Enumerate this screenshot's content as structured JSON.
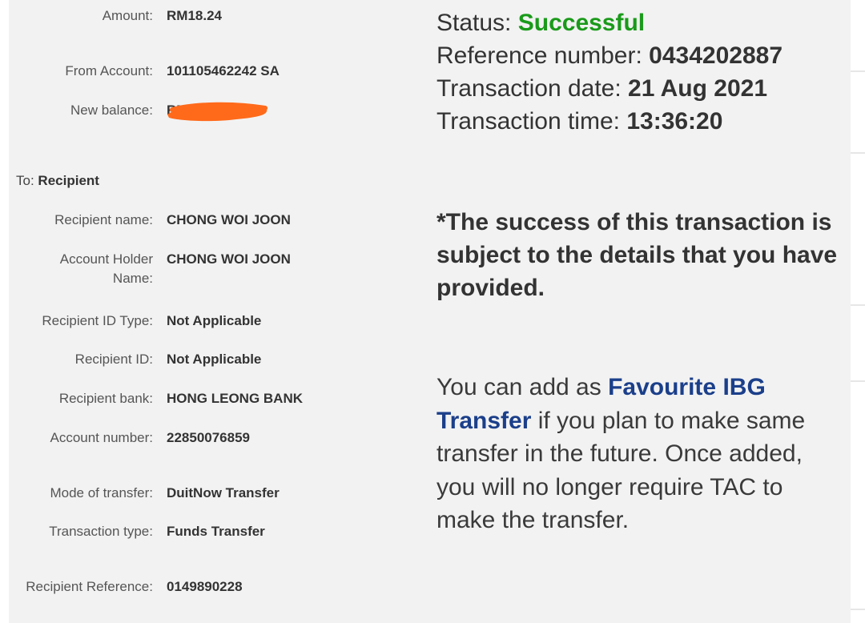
{
  "details": {
    "amount_label": "Amount:",
    "amount_value": "RM18.24",
    "from_account_label": "From Account:",
    "from_account_value": "101105462242 SA",
    "new_balance_label": "New balance:",
    "new_balance_value": "RM",
    "to_label": "To:",
    "to_value": "Recipient",
    "recipient_name_label": "Recipient name:",
    "recipient_name_value": "CHONG WOI JOON",
    "account_holder_label": "Account Holder Name:",
    "account_holder_value": "CHONG WOI JOON",
    "recipient_id_type_label": "Recipient ID Type:",
    "recipient_id_type_value": "Not Applicable",
    "recipient_id_label": "Recipient ID:",
    "recipient_id_value": "Not Applicable",
    "recipient_bank_label": "Recipient bank:",
    "recipient_bank_value": "HONG LEONG BANK",
    "account_number_label": "Account number:",
    "account_number_value": "22850076859",
    "mode_label": "Mode of transfer:",
    "mode_value": "DuitNow Transfer",
    "txn_type_label": "Transaction type:",
    "txn_type_value": "Funds Transfer",
    "recipient_ref_label": "Recipient Reference:",
    "recipient_ref_value": "0149890228"
  },
  "status": {
    "status_label": "Status:",
    "status_value": "Successful",
    "reference_label": "Reference number:",
    "reference_value": "0434202887",
    "date_label": "Transaction date:",
    "date_value": "21 Aug 2021",
    "time_label": "Transaction time:",
    "time_value": "13:36:20"
  },
  "note": "*The success of this transaction is subject to the details that you have provided.",
  "favourite": {
    "prefix": "You can add as ",
    "link": "Favourite IBG Transfer",
    "suffix": " if you plan to make same transfer in the future. Once added, you will no longer require TAC to make the transfer."
  },
  "colors": {
    "panel_bg": "#f2f2f2",
    "success": "#1a9a1a",
    "link": "#1b3f8a",
    "redaction": "#ff6a1a"
  }
}
